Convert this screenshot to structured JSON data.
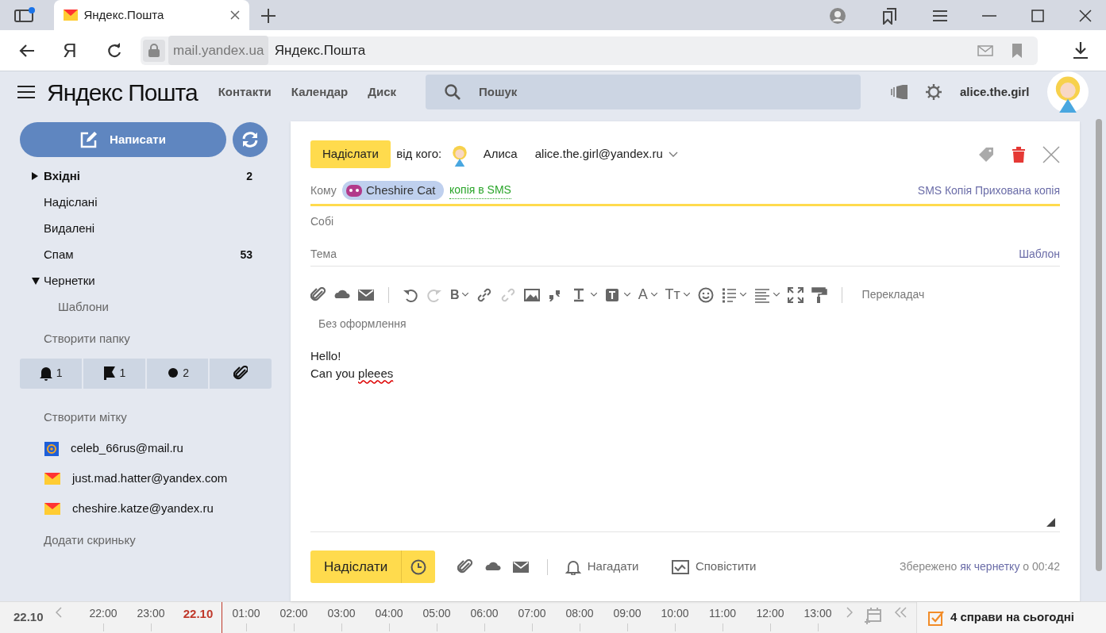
{
  "browser": {
    "tab_title": "Яндекс.Пошта",
    "home_glyph": "Я",
    "address_domain": "mail.yandex.ua",
    "address_title": "Яндекс.Пошта"
  },
  "header": {
    "logo": "**Яндекс** Пошта",
    "nav": [
      "Контакти",
      "Календар",
      "Диск"
    ],
    "search": {
      "placeholder": "Пошук"
    },
    "username": "alice.the.girl"
  },
  "sidebar": {
    "compose": "Написати",
    "folders": [
      {
        "kind": "group",
        "label": "Вхідні",
        "count": "2",
        "unread": true,
        "expanded": false
      },
      {
        "kind": "folder",
        "label": "Надіслані",
        "unread": false
      },
      {
        "kind": "folder",
        "label": "Видалені",
        "unread": false
      },
      {
        "kind": "folder",
        "label": "Спам",
        "count": "53",
        "unread": false
      },
      {
        "kind": "group",
        "label": "Чернетки",
        "unread": false,
        "expanded": true,
        "children": [
          {
            "label": "Шаблони",
            "unread": false
          }
        ]
      }
    ],
    "create_folder": "Створити папку",
    "filters": [
      {
        "kind": "reminder",
        "count": "1"
      },
      {
        "kind": "flag",
        "count": "1"
      },
      {
        "kind": "unread",
        "count": "2"
      },
      {
        "kind": "attachment"
      }
    ],
    "create_label": "Створити мітку",
    "mailboxes": [
      {
        "kind": "mailru",
        "address": "celeb_66rus@mail.ru"
      },
      {
        "kind": "yandex",
        "address": "just.mad.hatter@yandex.com"
      },
      {
        "kind": "yandex",
        "address": "cheshire.katze@yandex.ru"
      }
    ],
    "add_mailbox": "Додати скриньку"
  },
  "compose": {
    "send": "Надіслати",
    "from_label": "від кого:",
    "from_name": "Алиса",
    "from_email": "alice.the.girl@yandex.ru",
    "to_label": "Кому",
    "recipients": [
      {
        "name": "Cheshire Cat"
      }
    ],
    "sms_copy": "копія в SMS",
    "to_links": [
      "SMS",
      "Копія",
      "Прихована копія"
    ],
    "self_label": "Собі",
    "subject_label": "Тема",
    "template": "Шаблон",
    "toolbar": [
      {
        "kind": "attach",
        "disabled": false
      },
      {
        "kind": "cloud",
        "disabled": false
      },
      {
        "kind": "mail",
        "disabled": false
      },
      {
        "kind": "sep"
      },
      {
        "kind": "undo",
        "disabled": false
      },
      {
        "kind": "redo",
        "disabled": true
      },
      {
        "kind": "bold",
        "glyph": "B",
        "disabled": false
      },
      {
        "kind": "link",
        "disabled": false
      },
      {
        "kind": "unlink",
        "disabled": true
      },
      {
        "kind": "image",
        "disabled": false
      },
      {
        "kind": "quote",
        "disabled": false
      },
      {
        "kind": "textstyle",
        "disabled": false
      },
      {
        "kind": "textbg",
        "disabled": false
      },
      {
        "kind": "color",
        "glyph": "A",
        "disabled": false
      },
      {
        "kind": "size",
        "glyph": "Tт",
        "disabled": false
      },
      {
        "kind": "emoji",
        "disabled": false
      },
      {
        "kind": "list",
        "disabled": false
      },
      {
        "kind": "align",
        "disabled": false
      },
      {
        "kind": "fullscreen",
        "disabled": false
      },
      {
        "kind": "painter",
        "disabled": false
      },
      {
        "kind": "sep"
      }
    ],
    "translator": "Перекладач",
    "format": "Без оформлення",
    "body": [
      [
        {
          "text": "Hello!",
          "misspelled": false
        }
      ],
      [
        {
          "text": "Can you ",
          "misspelled": false
        },
        {
          "text": "pleees",
          "misspelled": true
        }
      ]
    ],
    "footer": {
      "send": "Надіслати",
      "remind": "Нагадати",
      "notify": "Сповістити",
      "saved_prefix": "Збережено",
      "saved_link": "як чернетку",
      "saved_suffix": "о 00:42"
    }
  },
  "timeline": {
    "date": "22.10",
    "slots": [
      {
        "kind": "hour",
        "label": "22:00"
      },
      {
        "kind": "hour",
        "label": "23:00"
      },
      {
        "kind": "date",
        "label": "22.10"
      },
      {
        "kind": "hour",
        "label": "01:00"
      },
      {
        "kind": "hour",
        "label": "02:00"
      },
      {
        "kind": "hour",
        "label": "03:00"
      },
      {
        "kind": "hour",
        "label": "04:00"
      },
      {
        "kind": "hour",
        "label": "05:00"
      },
      {
        "kind": "hour",
        "label": "06:00"
      },
      {
        "kind": "hour",
        "label": "07:00"
      },
      {
        "kind": "hour",
        "label": "08:00"
      },
      {
        "kind": "hour",
        "label": "09:00"
      },
      {
        "kind": "hour",
        "label": "10:00"
      },
      {
        "kind": "hour",
        "label": "11:00"
      },
      {
        "kind": "hour",
        "label": "12:00"
      },
      {
        "kind": "hour",
        "label": "13:00"
      }
    ],
    "tasks": "4 справи на сьогодні"
  }
}
